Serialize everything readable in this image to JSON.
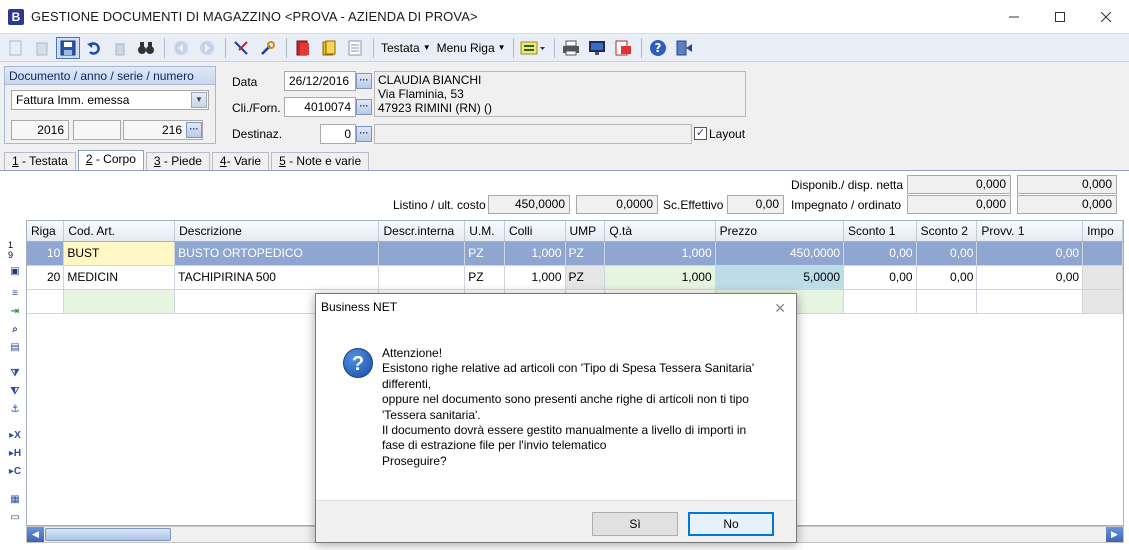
{
  "window": {
    "app_letter": "B",
    "title": "GESTIONE DOCUMENTI DI MAGAZZINO <PROVA - AZIENDA DI PROVA>"
  },
  "toolbar": {
    "menu_testata": "Testata",
    "menu_riga": "Menu Riga"
  },
  "document": {
    "group_title": "Documento / anno / serie / numero",
    "type": "Fattura Imm. emessa",
    "year": "2016",
    "series": "",
    "number": "216"
  },
  "header": {
    "date_label": "Data",
    "date_value": "26/12/2016",
    "cli_label": "Cli./Forn.",
    "cli_value": "4010074",
    "dest_label": "Destinaz.",
    "dest_value": "0",
    "customer_name": "CLAUDIA BIANCHI",
    "customer_address": "Via Flaminia, 53",
    "customer_city": "47923 RIMINI (RN)   ()",
    "layout_label": "Layout",
    "layout_checked": "✓"
  },
  "tabs": [
    {
      "key": "1",
      "label": " - Testata"
    },
    {
      "key": "2",
      "label": " - Corpo"
    },
    {
      "key": "3",
      "label": " - Piede"
    },
    {
      "key": "4",
      "label": "- Varie"
    },
    {
      "key": "5",
      "label": " - Note e varie"
    }
  ],
  "summary": {
    "disp_label": "Disponib./ disp. netta",
    "disp_1": "0,000",
    "disp_2": "0,000",
    "listino_label": "Listino / ult. costo",
    "listino_1": "450,0000",
    "listino_2": "0,0000",
    "sc_label": "Sc.Effettivo",
    "sc_value": "0,00",
    "impegnato_label": "Impegnato / ordinato",
    "impegnato_1": "0,000",
    "impegnato_2": "0,000"
  },
  "grid": {
    "columns": [
      "Riga",
      "Cod. Art.",
      "Descrizione",
      "Descr.interna",
      "U.M.",
      "Colli",
      "UMP",
      "Q.tà",
      "Prezzo",
      "Sconto 1",
      "Sconto 2",
      "Provv. 1",
      "Impo"
    ],
    "rows": [
      [
        "10",
        "BUST",
        "BUSTO ORTOPEDICO",
        "",
        "PZ",
        "1,000",
        "PZ",
        "1,000",
        "450,0000",
        "0,00",
        "0,00",
        "0,00",
        ""
      ],
      [
        "20",
        "MEDICIN",
        "TACHIPIRINA 500",
        "",
        "PZ",
        "1,000",
        "PZ",
        "1,000",
        "5,0000",
        "0,00",
        "0,00",
        "0,00",
        ""
      ]
    ],
    "row_marker": "1\n9"
  },
  "dialog": {
    "title": "Business NET",
    "message": "Attenzione!\nEsistono righe relative ad articoli con 'Tipo di Spesa Tessera Sanitaria'\ndifferenti,\noppure nel documento sono presenti anche righe di articoli non ti tipo\n'Tessera sanitaria'.\nIl documento dovrà essere gestito manualmente a livello di importi in\nfase di estrazione file per l'invio telematico\nProseguire?",
    "yes_label": "Sì",
    "no_label": "No"
  }
}
